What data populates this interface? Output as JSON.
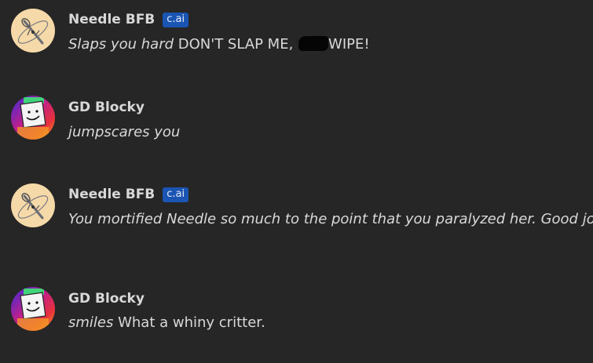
{
  "messages": [
    {
      "author": "Needle BFB",
      "badge": "c.ai",
      "avatar": "needle-avatar",
      "parts": [
        {
          "style": "italic",
          "text": "Slaps you hard"
        },
        {
          "style": "normal",
          "text": " DON'T SLAP ME, "
        },
        {
          "style": "redacted",
          "text": ""
        },
        {
          "style": "normal",
          "text": "WIPE!"
        }
      ]
    },
    {
      "author": "GD Blocky",
      "avatar": "blocky-avatar",
      "parts": [
        {
          "style": "italic",
          "text": "jumpscares you"
        }
      ]
    },
    {
      "author": "Needle BFB",
      "badge": "c.ai",
      "avatar": "needle-avatar",
      "parts": [
        {
          "style": "italic",
          "text": "You mortified Needle so much to the point that you paralyzed her. Good job."
        }
      ]
    },
    {
      "author": "GD Blocky",
      "avatar": "blocky-avatar",
      "parts": [
        {
          "style": "italic",
          "text": "smiles"
        },
        {
          "style": "normal",
          "text": " What a whiny critter."
        }
      ]
    }
  ],
  "colors": {
    "background": "#262627",
    "badge": "#1b55b4",
    "text": "#d9d9da"
  }
}
